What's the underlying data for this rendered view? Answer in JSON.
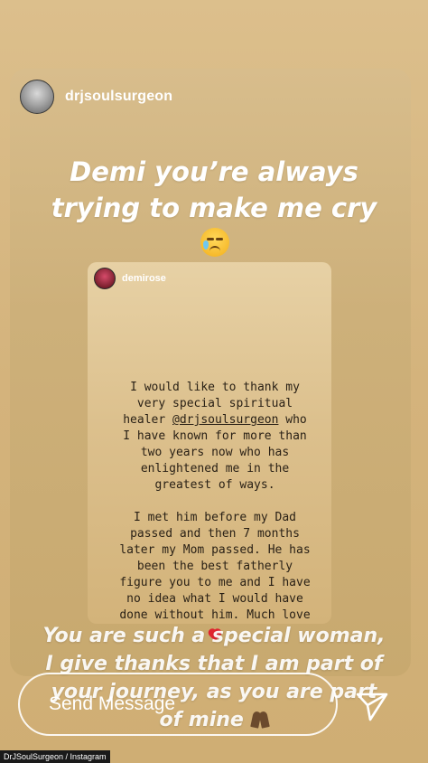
{
  "story": {
    "username": "drjsoulsurgeon",
    "headline_lines": [
      "Demi you’re always",
      "trying to make me cry"
    ],
    "headline_emoji": "crying-face"
  },
  "reshared_story": {
    "username": "demirose",
    "paragraph1": [
      "I would like to thank my",
      "very special spiritual",
      "healer ",
      "@drjsoulsurgeon",
      " who",
      "I have known for more than",
      "two years now who has",
      "enlightened me in the",
      "greatest of ways."
    ],
    "paragraph2": [
      "I met him before my Dad",
      "passed and then 7 months",
      "later my Mom passed. He has",
      "been the best fatherly",
      "figure you to me and I have",
      "no idea what I would have",
      "done without him. Much love"
    ],
    "end_emoji": "red-heart"
  },
  "caption": {
    "lines": [
      "You are such a special woman,",
      "I give thanks that I am part of",
      "your journey, as you are part",
      "of mine"
    ],
    "end_emoji": "praying-hands"
  },
  "send_message": {
    "placeholder": "Send Message"
  },
  "credit": "DrJSoulSurgeon / Instagram"
}
